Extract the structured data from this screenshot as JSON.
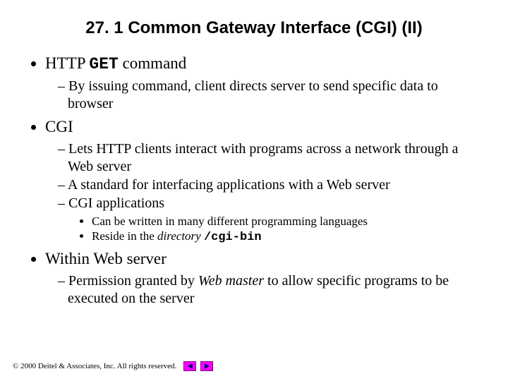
{
  "title": "27. 1 Common Gateway Interface (CGI) (II)",
  "bullets": {
    "b1_pre": "HTTP ",
    "b1_code": "GET",
    "b1_post": " command",
    "b1_1": "By issuing command, client directs server to send specific data to browser",
    "b2": "CGI",
    "b2_1": "Lets HTTP clients interact with programs across a network through a Web server",
    "b2_2": "A standard for interfacing applications with a Web server",
    "b2_3": "CGI applications",
    "b2_3_1": "Can be written in many different programming languages",
    "b2_3_2_pre": "Reside in the ",
    "b2_3_2_ital": "directory ",
    "b2_3_2_code": "/cgi-bin",
    "b3": "Within Web server",
    "b3_1_pre": "Permission granted by ",
    "b3_1_ital": "Web master",
    "b3_1_post": " to allow specific programs to be executed on the server"
  },
  "footer": {
    "copyright": "© 2000 Deitel & Associates, Inc.  All rights reserved."
  }
}
